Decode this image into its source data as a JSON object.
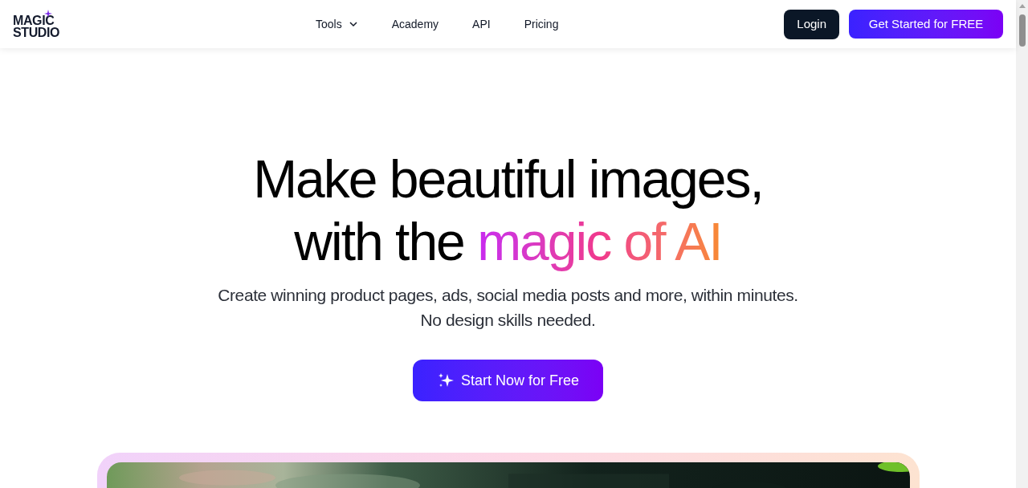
{
  "logo": {
    "lines": [
      "MAGIC",
      "STUDIO"
    ]
  },
  "nav": [
    {
      "label": "Tools",
      "dropdown": true
    },
    {
      "label": "Academy",
      "dropdown": false
    },
    {
      "label": "API",
      "dropdown": false
    },
    {
      "label": "Pricing",
      "dropdown": false
    }
  ],
  "login": "Login",
  "cta_header": "Get Started for FREE",
  "hero": {
    "title_line1": "Make beautiful images,",
    "title_line2": "with the ",
    "title_highlight": "magic of AI",
    "subtitle_line1": "Create winning product pages, ads, social media posts and more, within minutes.",
    "subtitle_line2": "No design skills needed.",
    "button": "Start Now for Free"
  }
}
